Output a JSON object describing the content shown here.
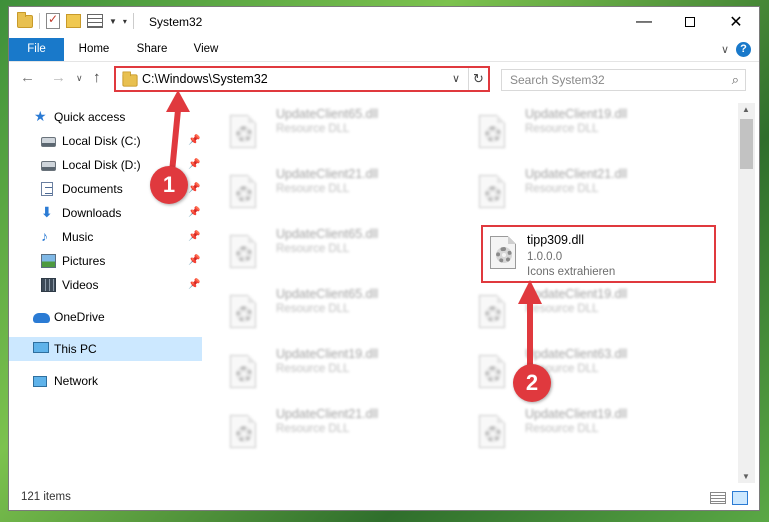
{
  "window": {
    "title": "System32",
    "controls": {
      "minimize": "—",
      "close": "✕"
    }
  },
  "ribbon": {
    "tabs": [
      "File",
      "Home",
      "Share",
      "View"
    ]
  },
  "nav": {
    "address": "C:\\Windows\\System32",
    "search_placeholder": "Search System32"
  },
  "sidebar": {
    "items": [
      {
        "label": "Quick access",
        "icon": "star-icon"
      },
      {
        "label": "Local Disk (C:)",
        "icon": "drive-icon",
        "pinned": true
      },
      {
        "label": "Local Disk (D:)",
        "icon": "drive-icon",
        "pinned": true
      },
      {
        "label": "Documents",
        "icon": "documents-icon",
        "pinned": true
      },
      {
        "label": "Downloads",
        "icon": "downloads-icon",
        "pinned": true
      },
      {
        "label": "Music",
        "icon": "music-icon",
        "pinned": true
      },
      {
        "label": "Pictures",
        "icon": "pictures-icon",
        "pinned": true
      },
      {
        "label": "Videos",
        "icon": "videos-icon",
        "pinned": true
      },
      {
        "label": "OneDrive",
        "icon": "onedrive-icon"
      },
      {
        "label": "This PC",
        "icon": "pc-icon",
        "selected": true
      },
      {
        "label": "Network",
        "icon": "network-icon"
      }
    ]
  },
  "files": {
    "blurred": [
      {
        "name": "UpdateClient65.dll",
        "desc": "Resource DLL"
      },
      {
        "name": "UpdateClient19.dll",
        "desc": "Resource DLL"
      },
      {
        "name": "UpdateClient21.dll",
        "desc": "Resource DLL"
      },
      {
        "name": "UpdateClient21.dll",
        "desc": "Resource DLL"
      },
      {
        "name": "UpdateClient65.dll",
        "desc": "Resource DLL"
      },
      {
        "name": "UpdateClient65.dll",
        "desc": "Resource DLL"
      },
      {
        "name": "UpdateClient19.dll",
        "desc": "Resource DLL"
      },
      {
        "name": "UpdateClient19.dll",
        "desc": "Resource DLL"
      },
      {
        "name": "UpdateClient63.dll",
        "desc": "Resource DLL"
      },
      {
        "name": "UpdateClient21.dll",
        "desc": "Resource DLL"
      },
      {
        "name": "UpdateClient19.dll",
        "desc": "Resource DLL"
      }
    ],
    "selected": {
      "name": "tipp309.dll",
      "version": "1.0.0.0",
      "desc": "Icons extrahieren"
    }
  },
  "status": {
    "item_count": "121 items"
  },
  "annotations": {
    "step1": "1",
    "step2": "2",
    "color": "#e0393e"
  },
  "colors": {
    "accent": "#1979ca",
    "highlight": "#e0393e",
    "selection": "#cce8ff"
  }
}
